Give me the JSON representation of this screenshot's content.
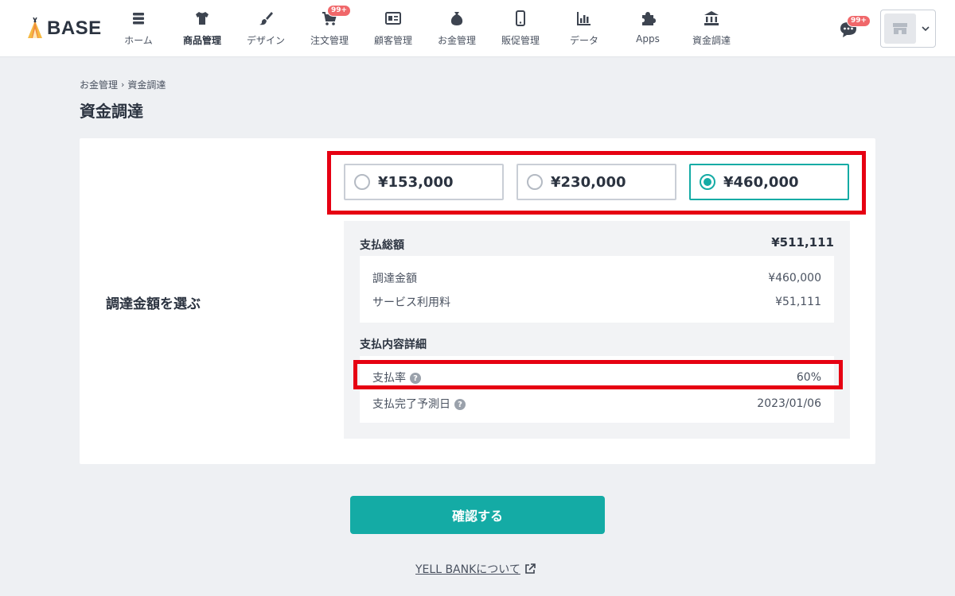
{
  "brand": {
    "logo_text": "BASE"
  },
  "nav": [
    {
      "label": "ホーム",
      "icon": "home-list-icon"
    },
    {
      "label": "商品管理",
      "icon": "tshirt-icon",
      "active": true
    },
    {
      "label": "デザイン",
      "icon": "brush-icon"
    },
    {
      "label": "注文管理",
      "icon": "cart-icon",
      "badge": "99+"
    },
    {
      "label": "顧客管理",
      "icon": "id-card-icon"
    },
    {
      "label": "お金管理",
      "icon": "money-bag-icon"
    },
    {
      "label": "販促管理",
      "icon": "smartphone-icon"
    },
    {
      "label": "データ",
      "icon": "bar-chart-icon"
    },
    {
      "label": "Apps",
      "icon": "puzzle-icon"
    },
    {
      "label": "資金調達",
      "icon": "bank-icon"
    }
  ],
  "chat": {
    "badge": "99+"
  },
  "breadcrumb": {
    "parent": "お金管理",
    "separator": "›",
    "current": "資金調達"
  },
  "page_title": "資金調達",
  "section_label": "調達金額を選ぶ",
  "amount_options": [
    {
      "label": "¥153,000",
      "selected": false
    },
    {
      "label": "¥230,000",
      "selected": false
    },
    {
      "label": "¥460,000",
      "selected": true
    }
  ],
  "summary": {
    "total_label": "支払総額",
    "total_value": "¥511,111",
    "items": [
      {
        "label": "調達金額",
        "value": "¥460,000"
      },
      {
        "label": "サービス利用料",
        "value": "¥51,111"
      }
    ],
    "detail_heading": "支払内容詳細",
    "details": [
      {
        "label": "支払率",
        "value": "60%",
        "help": "?"
      },
      {
        "label": "支払完了予測日",
        "value": "2023/01/06",
        "help": "?"
      }
    ]
  },
  "confirm_label": "確認する",
  "about_link": "YELL BANKについて",
  "colors": {
    "accent": "#14aba5",
    "highlight": "#e60012",
    "badge": "#f0676a"
  }
}
